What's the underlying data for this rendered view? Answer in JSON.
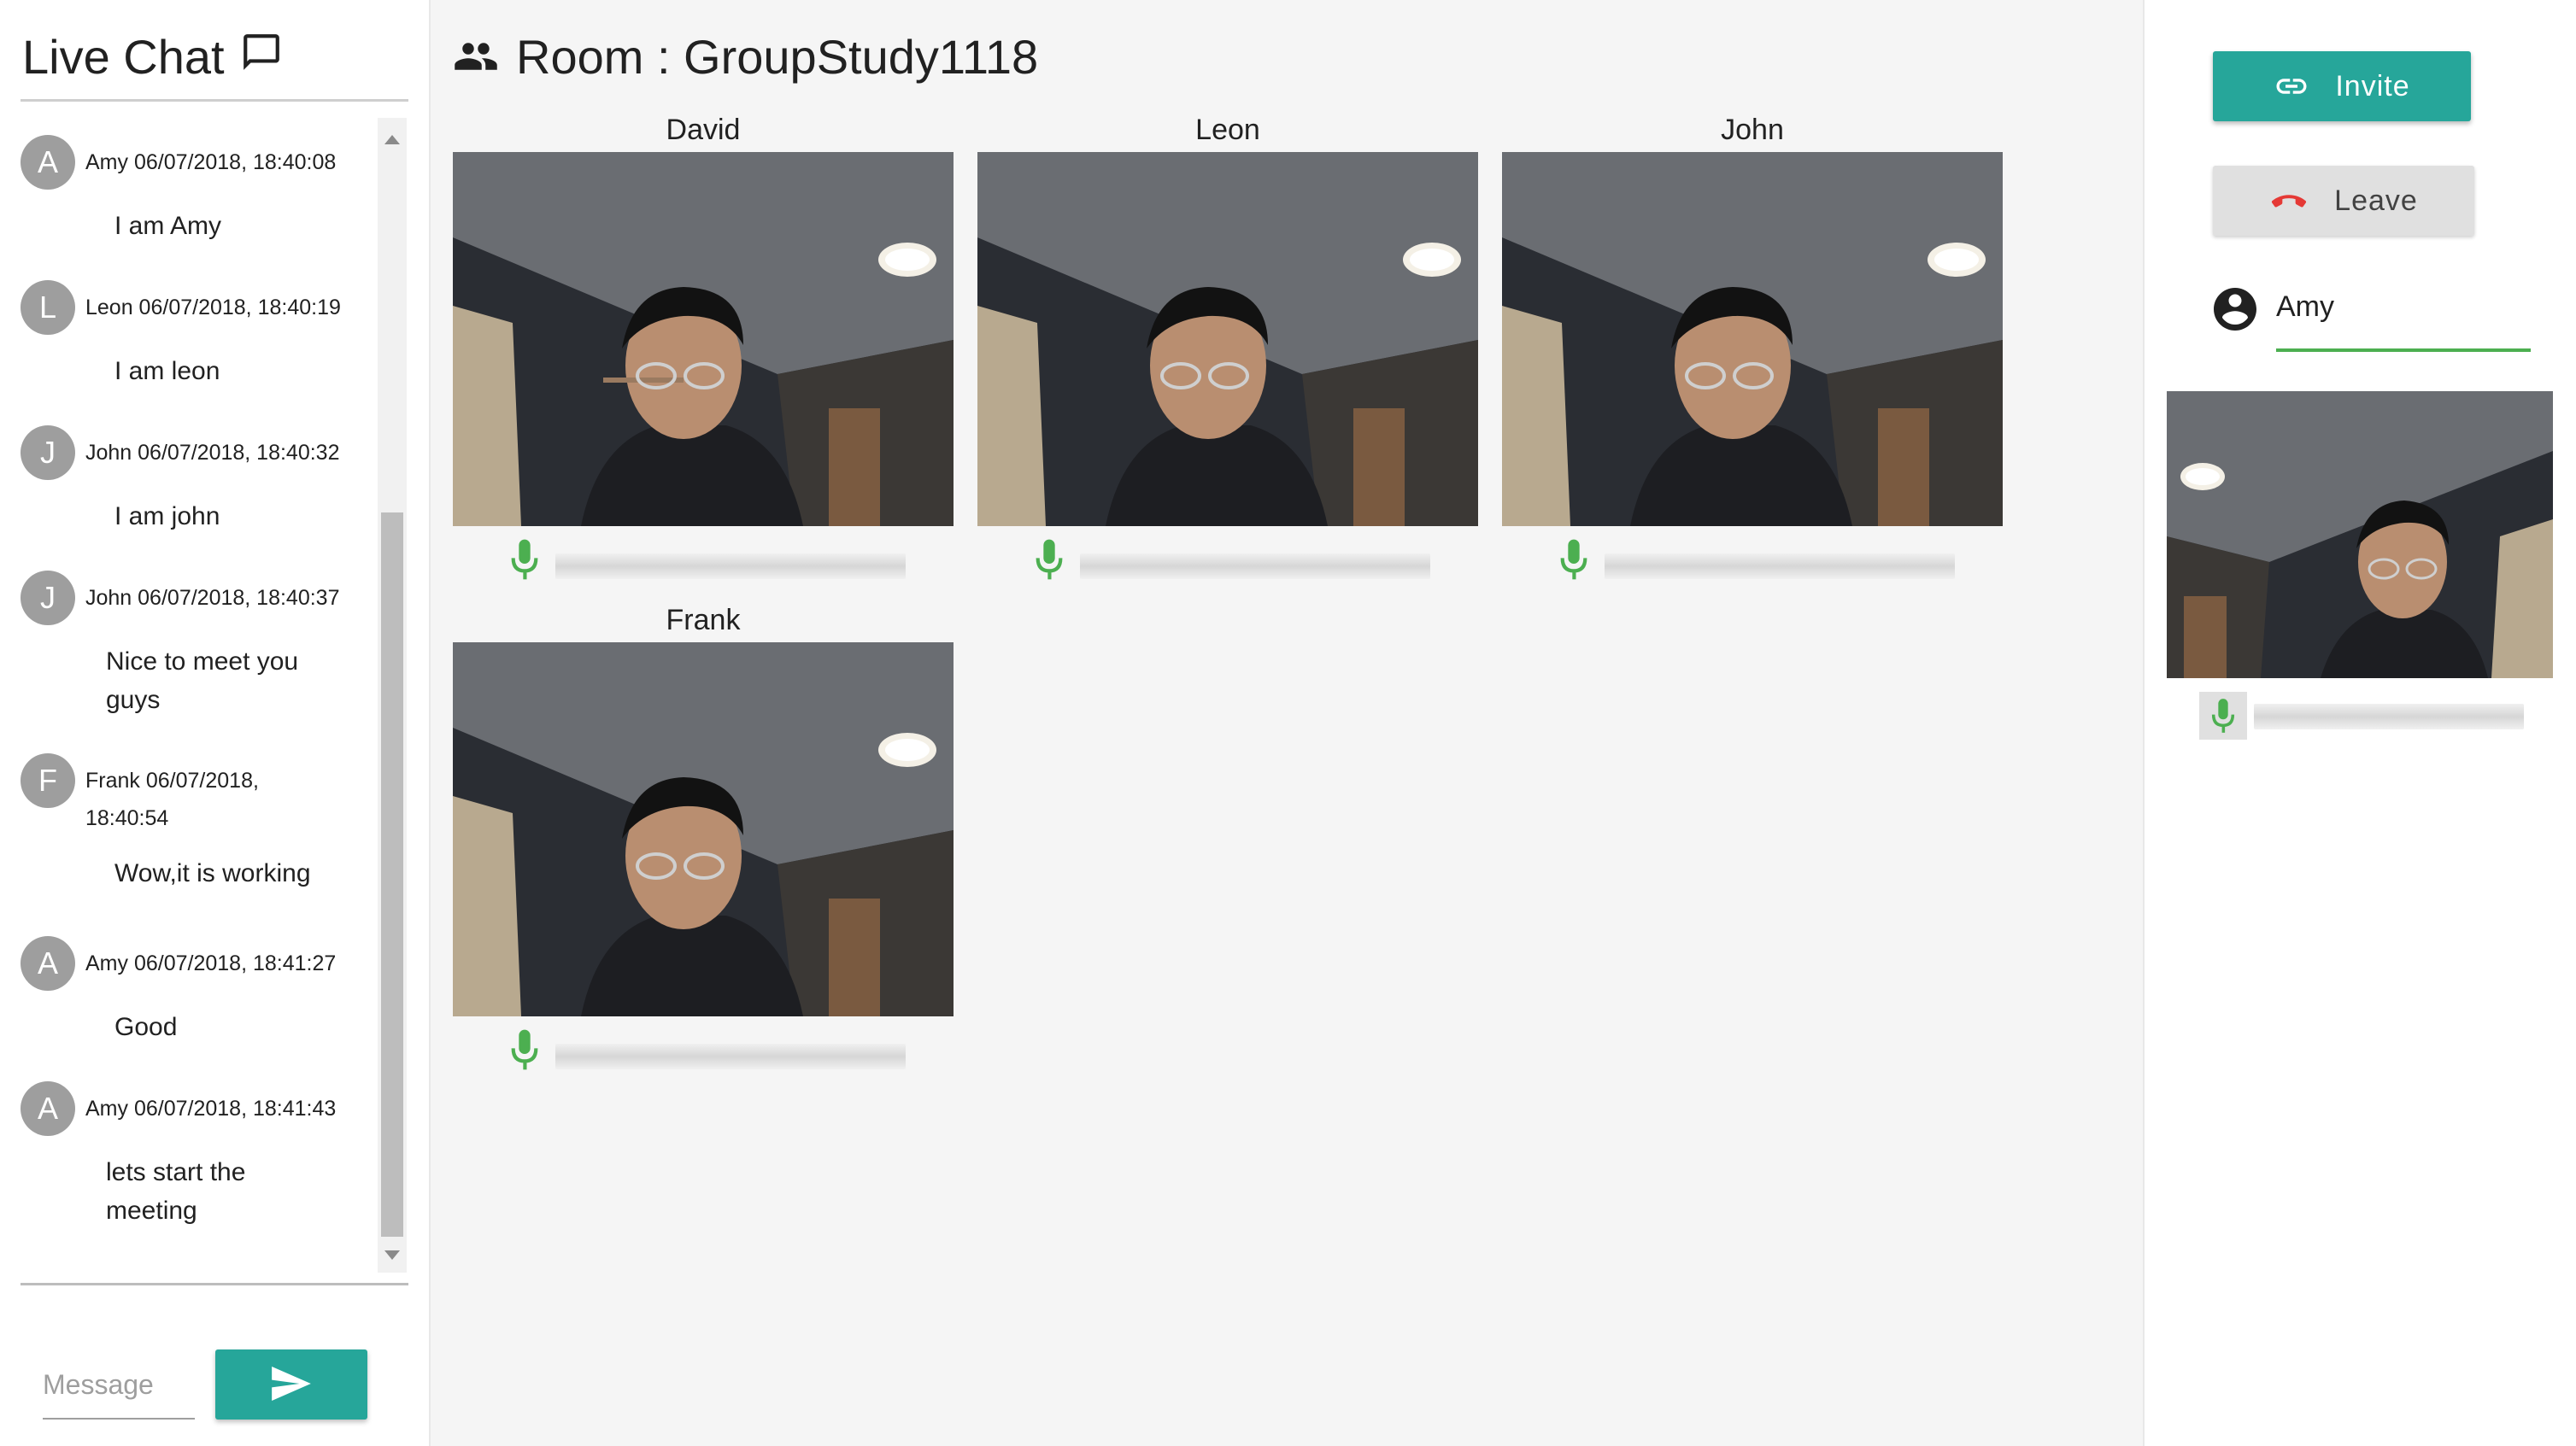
{
  "chat": {
    "title": "Live Chat",
    "messages": [
      {
        "initial": "A",
        "meta": "Amy 06/07/2018, 18:40:08",
        "text": "I am Amy"
      },
      {
        "initial": "L",
        "meta": "Leon 06/07/2018, 18:40:19",
        "text": "I am leon"
      },
      {
        "initial": "J",
        "meta": "John 06/07/2018, 18:40:32",
        "text": "I am john"
      },
      {
        "initial": "J",
        "meta": "John 06/07/2018, 18:40:37",
        "text": "Nice to meet you guys"
      },
      {
        "initial": "F",
        "meta": "Frank 06/07/2018, 18:40:54",
        "text": "Wow,it is working"
      },
      {
        "initial": "A",
        "meta": "Amy 06/07/2018, 18:41:27",
        "text": "Good"
      },
      {
        "initial": "A",
        "meta": "Amy 06/07/2018, 18:41:43",
        "text": "lets start the meeting"
      }
    ],
    "input_placeholder": "Message",
    "input_value": ""
  },
  "room": {
    "title": "Room : GroupStudy1118",
    "participants": [
      {
        "name": "David"
      },
      {
        "name": "Leon"
      },
      {
        "name": "John"
      },
      {
        "name": "Frank"
      }
    ]
  },
  "sidebar": {
    "invite_label": "Invite",
    "leave_label": "Leave",
    "current_user": "Amy"
  },
  "colors": {
    "accent": "#26a69a",
    "mic": "#4caf50",
    "leave_icon": "#e53935",
    "avatar": "#9e9e9e"
  },
  "icons": {
    "chat": "chat-bubble-icon",
    "room": "group-icon",
    "send": "send-icon",
    "invite": "link-icon",
    "leave": "call-end-icon",
    "user": "account-circle-icon",
    "mic": "mic-icon"
  }
}
